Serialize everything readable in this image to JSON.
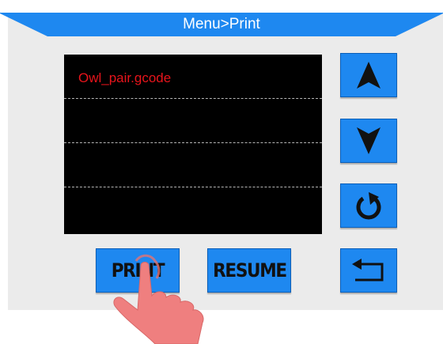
{
  "header": {
    "title": "Menu>Print"
  },
  "file_list": {
    "rows": [
      {
        "name": "Owl_pair.gcode"
      },
      {
        "name": ""
      },
      {
        "name": ""
      },
      {
        "name": ""
      }
    ]
  },
  "buttons": {
    "print_label": "PRINT",
    "resume_label": "RESUME"
  },
  "icons": {
    "up": "arrow-up-icon",
    "down": "arrow-down-icon",
    "refresh": "refresh-icon",
    "back": "back-icon",
    "hand": "tap-hand-icon"
  },
  "colors": {
    "accent": "#1e88f0",
    "file_text": "#e8141b",
    "panel": "#ebebeb",
    "list_bg": "#000000"
  }
}
